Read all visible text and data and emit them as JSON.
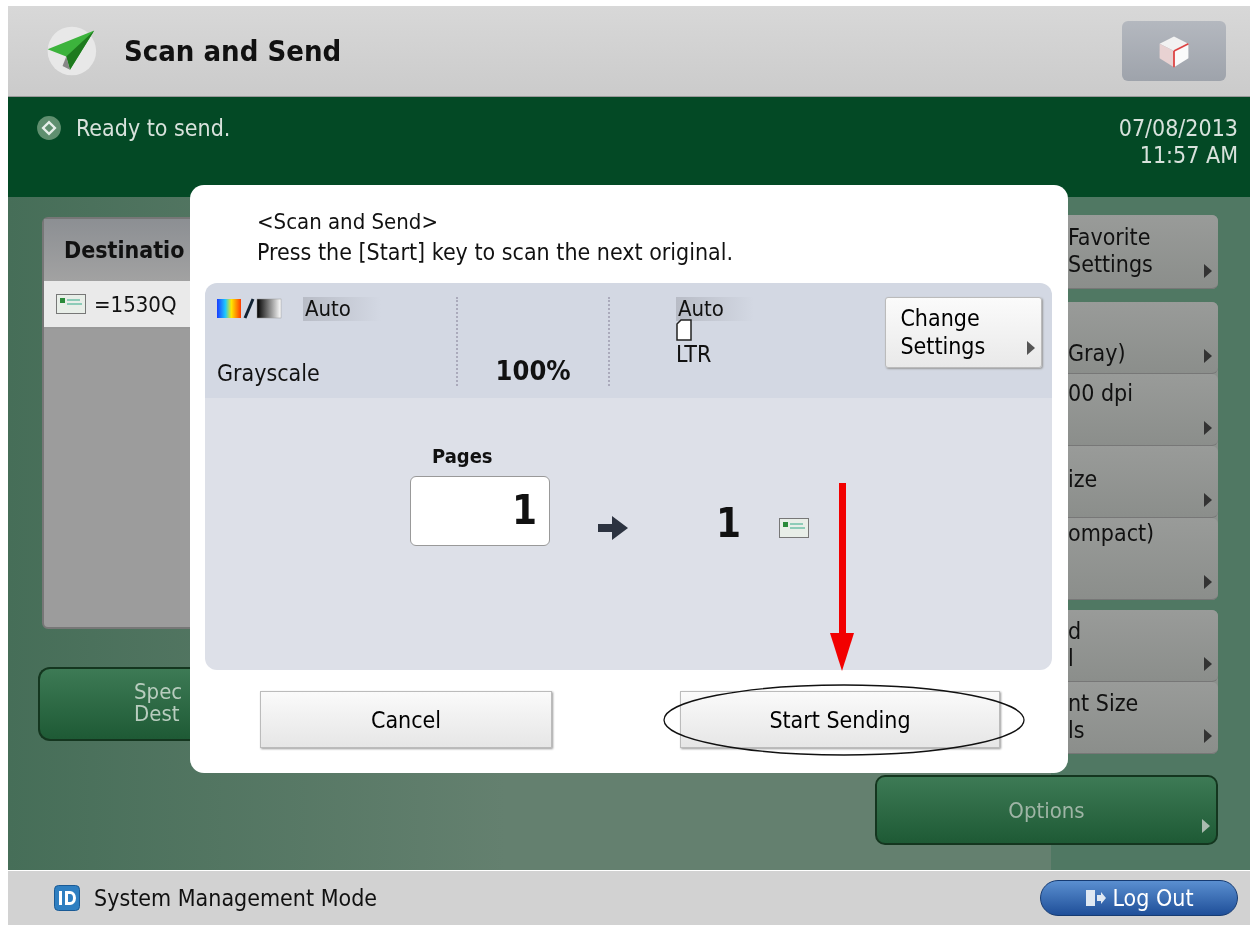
{
  "header": {
    "title": "Scan and Send"
  },
  "status_bar": {
    "message": "Ready to send.",
    "date": "07/08/2013",
    "time": "11:57 AM"
  },
  "destinations": {
    "heading": "Destinatio",
    "entries": [
      "=1530Q"
    ]
  },
  "left_button": {
    "lines": [
      "Spec",
      "Dest"
    ]
  },
  "right_button_groups": [
    [
      {
        "lines": [
          "Favorite",
          "Settings"
        ]
      }
    ],
    [
      {
        "lines": [
          "Gray)"
        ]
      },
      {
        "lines": [
          "00 dpi"
        ]
      },
      {
        "lines": [
          "ize"
        ]
      },
      {
        "lines": [
          "ompact)"
        ]
      }
    ],
    [
      {
        "lines": [
          "d",
          "l"
        ]
      },
      {
        "lines": [
          "nt Size",
          "ls"
        ]
      }
    ]
  ],
  "options_button": "Options",
  "dialog": {
    "title": "<Scan and Send>",
    "message": "Press the [Start] key to scan the next original.",
    "settings": {
      "color_badge": "Auto",
      "color_mode": "Grayscale",
      "ratio": "100%",
      "size_badge": "Auto",
      "paper": "LTR"
    },
    "change_button": [
      "Change",
      "Settings"
    ],
    "pages_label": "Pages",
    "pages_value": "1",
    "sent_count": "1",
    "buttons": [
      {
        "label": "Cancel",
        "highlighted": false
      },
      {
        "label": "Start Sending",
        "highlighted": true
      }
    ]
  },
  "footer": {
    "mode": "System Management Mode",
    "logout": "Log Out"
  }
}
